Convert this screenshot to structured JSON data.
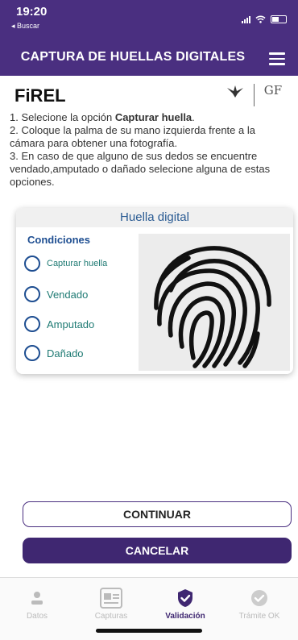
{
  "status": {
    "time": "19:20",
    "back": "◂ Buscar"
  },
  "header": {
    "title": "CAPTURA DE HUELLAS DIGITALES"
  },
  "brand": {
    "name": "FiREL",
    "logo2_text": "GF"
  },
  "instructions": {
    "l1_pre": "1. Selecione la opción ",
    "l1_bold": "Capturar huella",
    "l1_post": ".",
    "l2": "2. Coloque la palma de su mano izquierda frente a la cámara para obtener una fotografía.",
    "l3": "3. En caso de que alguno de sus dedos se encuentre vendado,amputado o dañado selecione alguna de estas opciones."
  },
  "card": {
    "title": "Huella digital",
    "conditions_title": "Condiciones",
    "options": [
      "Capturar huella",
      "Vendado",
      "Amputado",
      "Dañado"
    ]
  },
  "buttons": {
    "continue": "CONTINUAR",
    "cancel": "CANCELAR"
  },
  "tabs": [
    {
      "label": "Datos",
      "icon": "person-icon",
      "active": false
    },
    {
      "label": "Capturas",
      "icon": "photo-id-icon",
      "active": false
    },
    {
      "label": "Validación",
      "icon": "shield-check-icon",
      "active": true
    },
    {
      "label": "Trámite OK",
      "icon": "check-circle-icon",
      "active": false
    }
  ],
  "colors": {
    "primary": "#4a2f80",
    "label_teal": "#1e7a73",
    "radio_blue": "#1e4e91"
  }
}
